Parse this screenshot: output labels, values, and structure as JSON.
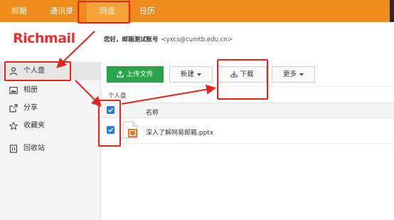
{
  "topnav": {
    "items": [
      {
        "label": "邮箱"
      },
      {
        "label": "通讯录"
      },
      {
        "label": "网盘",
        "active": true
      },
      {
        "label": "日历"
      }
    ]
  },
  "header": {
    "logo_text": "Richmail",
    "greeting": "您好，邮箱测试账号",
    "email": "<yxcs@cumtb.edu.cn>"
  },
  "sidebar": {
    "items": [
      {
        "label": "个人盘",
        "icon": "user-icon",
        "active": true
      },
      {
        "label": "相册",
        "icon": "image-icon"
      },
      {
        "label": "分享",
        "icon": "share-icon"
      },
      {
        "label": "收藏夹",
        "icon": "star-icon"
      },
      {
        "label": "回收站",
        "icon": "trash-icon"
      }
    ]
  },
  "toolbar": {
    "upload_label": "上传文件",
    "new_label": "新建",
    "download_label": "下载",
    "more_label": "更多"
  },
  "breadcrumb": "个人盘",
  "file_table": {
    "column_name": "名称",
    "rows": [
      {
        "name": "深入了解网易邮箱.pptx",
        "checked": true,
        "type": "pptx"
      }
    ]
  },
  "colors": {
    "nav_orange": "#f08c1b",
    "nav_active": "#f8a23a",
    "logo_red": "#e8312f",
    "primary_green": "#2aa54b",
    "checkbox_blue": "#2a78d6",
    "annotation_red": "#e8231c"
  }
}
